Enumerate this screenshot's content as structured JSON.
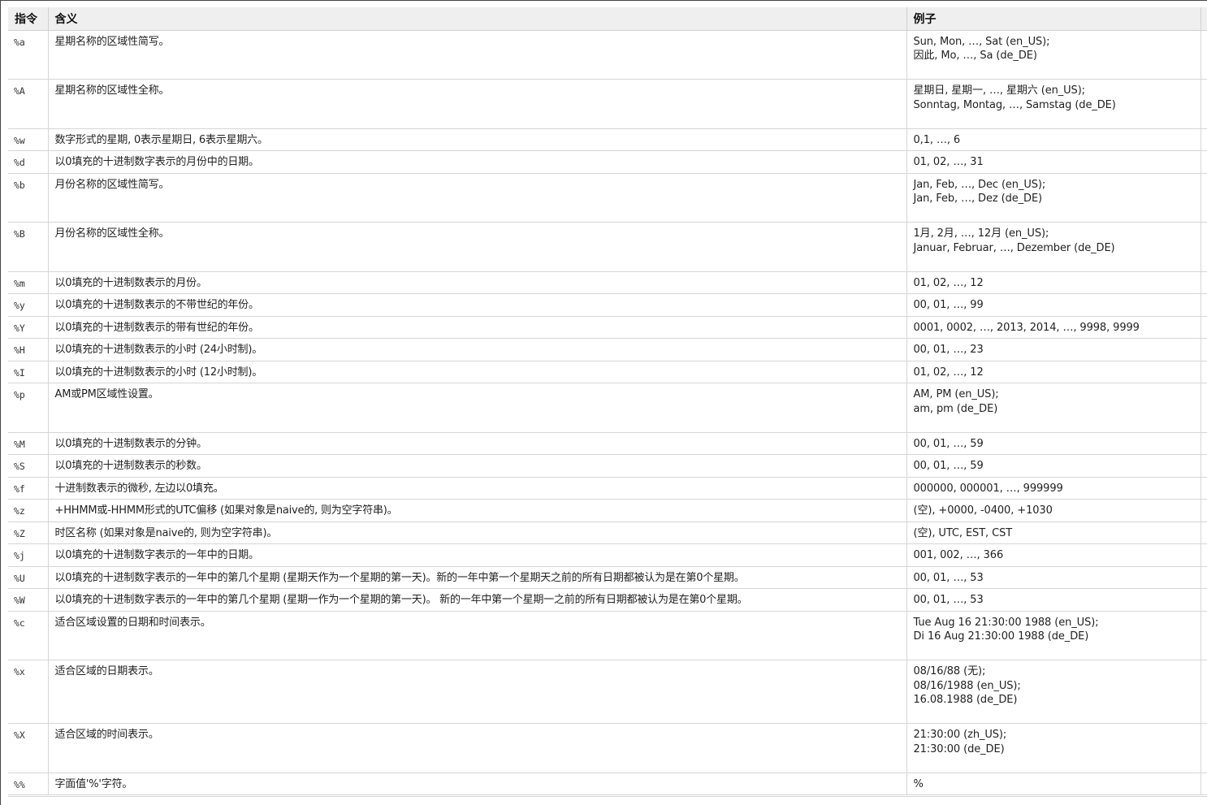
{
  "table": {
    "headers": {
      "directive": "指令",
      "meaning": "含义",
      "example": "例子"
    },
    "rows": [
      {
        "code": "%a",
        "meaning": "星期名称的区域性简写。",
        "examples": [
          "Sun, Mon, …, Sat (en_US);",
          "因此, Mo, …, Sa (de_DE)"
        ]
      },
      {
        "code": "%A",
        "meaning": "星期名称的区域性全称。",
        "examples": [
          "星期日, 星期一, …, 星期六 (en_US);",
          "Sonntag, Montag, …, Samstag (de_DE)"
        ]
      },
      {
        "code": "%w",
        "meaning": "数字形式的星期, 0表示星期日, 6表示星期六。",
        "examples": [
          "0,1, …, 6"
        ]
      },
      {
        "code": "%d",
        "meaning": "以0填充的十进制数字表示的月份中的日期。",
        "examples": [
          "01, 02, …, 31"
        ]
      },
      {
        "code": "%b",
        "meaning": "月份名称的区域性简写。",
        "examples": [
          "Jan, Feb, …, Dec (en_US);",
          "Jan, Feb, …, Dez (de_DE)"
        ]
      },
      {
        "code": "%B",
        "meaning": "月份名称的区域性全称。",
        "examples": [
          "1月, 2月, …, 12月 (en_US);",
          "Januar, Februar, …, Dezember (de_DE)"
        ]
      },
      {
        "code": "%m",
        "meaning": "以0填充的十进制数表示的月份。",
        "examples": [
          "01, 02, …, 12"
        ]
      },
      {
        "code": "%y",
        "meaning": "以0填充的十进制数表示的不带世纪的年份。",
        "examples": [
          "00, 01, …, 99"
        ]
      },
      {
        "code": "%Y",
        "meaning": "以0填充的十进制数表示的带有世纪的年份。",
        "examples": [
          "0001, 0002, …, 2013, 2014, …, 9998, 9999"
        ]
      },
      {
        "code": "%H",
        "meaning": "以0填充的十进制数表示的小时 (24小时制)。",
        "examples": [
          "00, 01, …, 23"
        ]
      },
      {
        "code": "%I",
        "meaning": "以0填充的十进制数表示的小时 (12小时制)。",
        "examples": [
          "01, 02, …, 12"
        ]
      },
      {
        "code": "%p",
        "meaning": "AM或PM区域性设置。",
        "examples": [
          "AM, PM (en_US);",
          "am, pm (de_DE)"
        ]
      },
      {
        "code": "%M",
        "meaning": "以0填充的十进制数表示的分钟。",
        "examples": [
          "00, 01, …, 59"
        ]
      },
      {
        "code": "%S",
        "meaning": "以0填充的十进制数表示的秒数。",
        "examples": [
          "00, 01, …, 59"
        ]
      },
      {
        "code": "%f",
        "meaning": "十进制数表示的微秒, 左边以0填充。",
        "examples": [
          "000000, 000001, …, 999999"
        ]
      },
      {
        "code": "%z",
        "meaning": "+HHMM或-HHMM形式的UTC偏移 (如果对象是naive的, 则为空字符串)。",
        "examples": [
          "(空), +0000, -0400, +1030"
        ]
      },
      {
        "code": "%Z",
        "meaning": "时区名称 (如果对象是naive的, 则为空字符串)。",
        "examples": [
          "(空), UTC, EST, CST"
        ]
      },
      {
        "code": "%j",
        "meaning": "以0填充的十进制数字表示的一年中的日期。",
        "examples": [
          "001, 002, …, 366"
        ]
      },
      {
        "code": "%U",
        "meaning": "以0填充的十进制数字表示的一年中的第几个星期 (星期天作为一个星期的第一天)。新的一年中第一个星期天之前的所有日期都被认为是在第0个星期。",
        "examples": [
          "00, 01, …, 53"
        ]
      },
      {
        "code": "%W",
        "meaning": "以0填充的十进制数字表示的一年中的第几个星期 (星期一作为一个星期的第一天)。 新的一年中第一个星期一之前的所有日期都被认为是在第0个星期。",
        "examples": [
          "00, 01, …, 53"
        ]
      },
      {
        "code": "%c",
        "meaning": "适合区域设置的日期和时间表示。",
        "examples": [
          "Tue Aug 16 21:30:00 1988 (en_US);",
          "Di 16 Aug 21:30:00 1988 (de_DE)"
        ]
      },
      {
        "code": "%x",
        "meaning": "适合区域的日期表示。",
        "examples": [
          "08/16/88 (无);",
          "08/16/1988 (en_US);",
          "16.08.1988 (de_DE)"
        ]
      },
      {
        "code": "%X",
        "meaning": "适合区域的时间表示。",
        "examples": [
          "21:30:00 (zh_US);",
          "21:30:00 (de_DE)"
        ]
      },
      {
        "code": "%%",
        "meaning": "字面值'%'字符。",
        "examples": [
          "%"
        ]
      }
    ]
  }
}
